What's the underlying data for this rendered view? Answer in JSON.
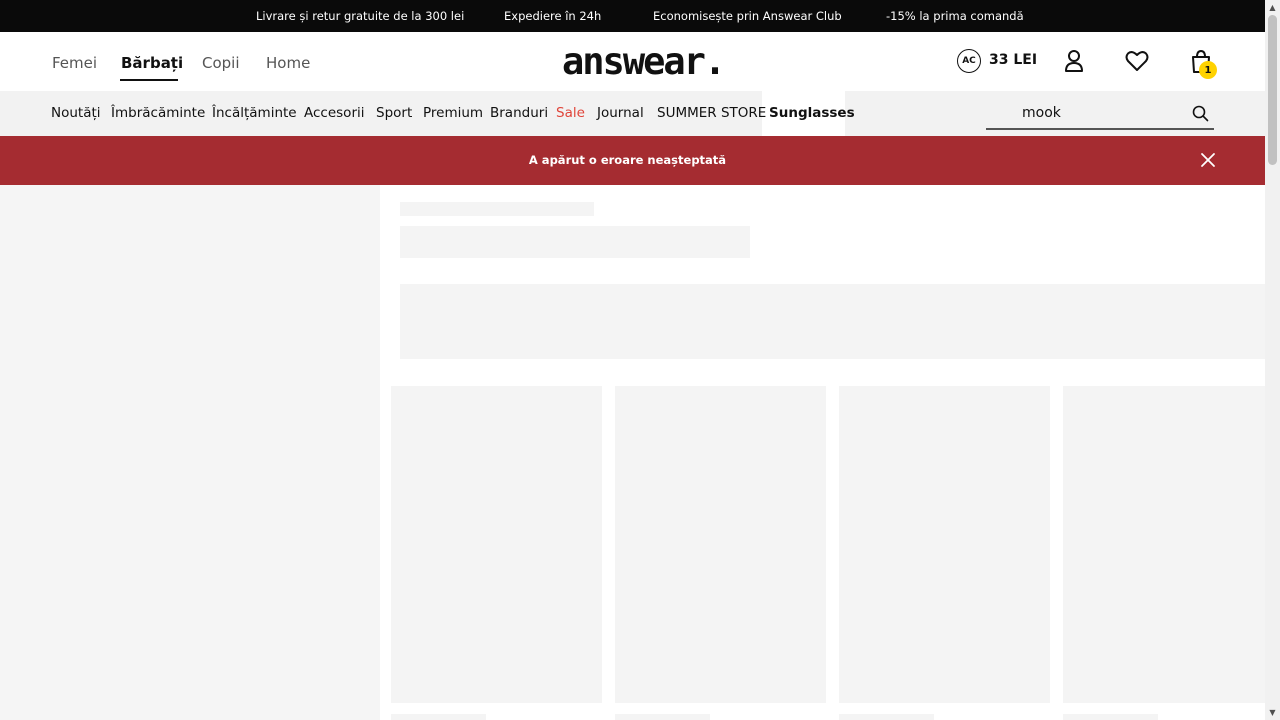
{
  "promo": {
    "item1": "Livrare și retur gratuite de la 300 lei",
    "item2": "Expediere în 24h",
    "item3": "Economisește prin Answear Club",
    "item4": "-15% la prima comandă"
  },
  "header": {
    "genders": [
      "Femei",
      "Bărbați",
      "Copii",
      "Home"
    ],
    "active_gender": "Bărbați",
    "logo": "answear.",
    "club_badge": "AC",
    "club_points": "33 LEI",
    "cart_count": "1"
  },
  "categories": {
    "items": [
      "Noutăți",
      "Îmbrăcăminte",
      "Încălțăminte",
      "Accesorii",
      "Sport",
      "Premium",
      "Branduri",
      "Sale",
      "Journal",
      "SUMMER STORE",
      "Sunglasses"
    ],
    "active": "Sunglasses",
    "sale_color": "#e0453a"
  },
  "search": {
    "value": "mook"
  },
  "error": {
    "message": "A apărut o eroare neașteptată",
    "background": "#a52c31"
  },
  "colors": {
    "promo_bg": "#0a0a0a",
    "nav_bg": "#f2f2f2",
    "cart_badge": "#ffd200",
    "placeholder": "#f4f4f4"
  }
}
